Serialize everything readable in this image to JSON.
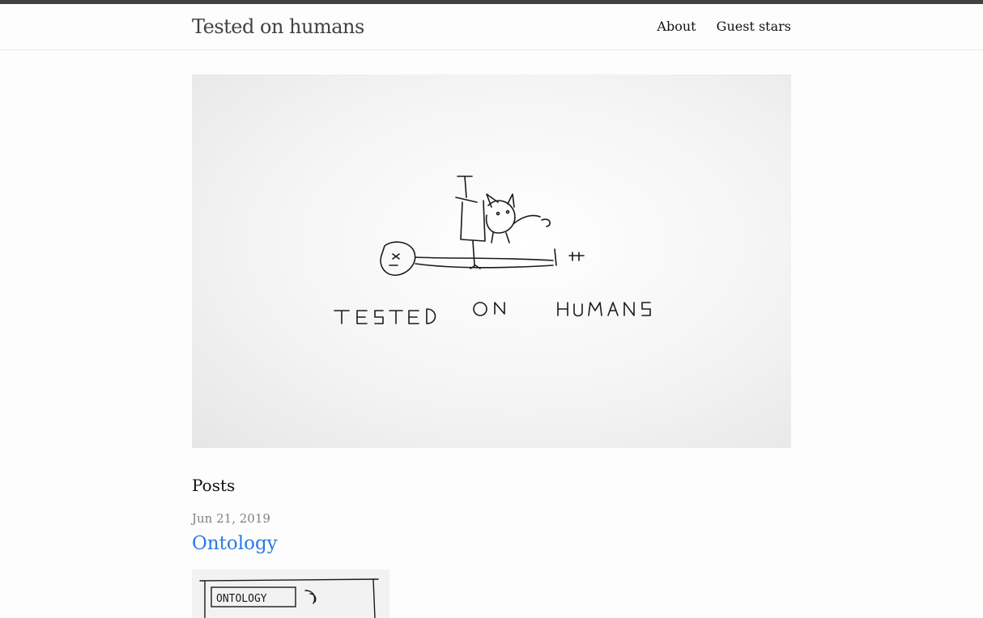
{
  "header": {
    "site_title": "Tested on humans",
    "nav": [
      {
        "label": "About"
      },
      {
        "label": "Guest stars"
      }
    ]
  },
  "hero": {
    "image_text": "TESTED ON HUMANS"
  },
  "main": {
    "posts_heading": "Posts",
    "posts": [
      {
        "date": "Jun 21, 2019",
        "title": "Ontology",
        "thumb_text": "ONTOLOGY"
      }
    ]
  },
  "colors": {
    "top_rule": "#424242",
    "link": "#2a7ae2",
    "meta": "#828282"
  }
}
